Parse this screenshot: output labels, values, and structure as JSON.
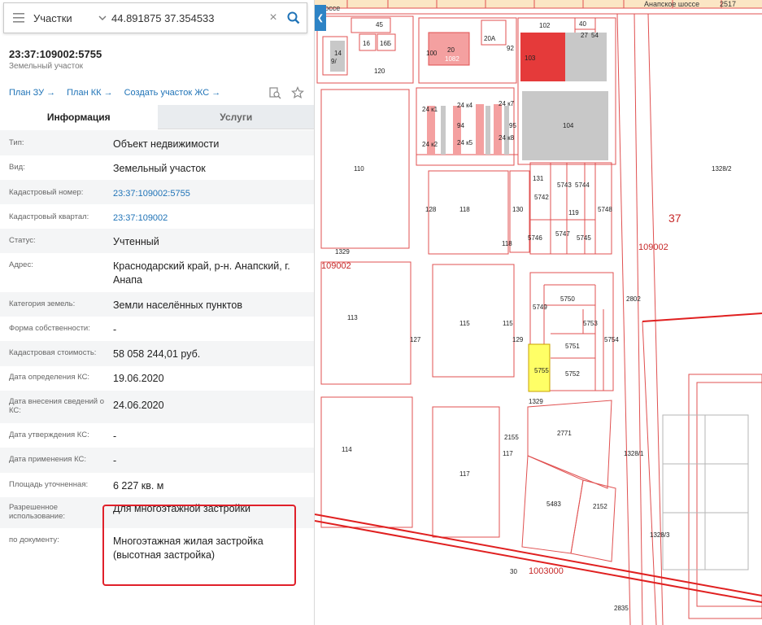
{
  "search": {
    "layer": "Участки",
    "query": "44.891875 37.354533"
  },
  "parcel": {
    "number": "23:37:109002:5755",
    "type_label": "Земельный участок"
  },
  "links": {
    "plan_zu": "План ЗУ →",
    "plan_kk": "План КК →",
    "create": "Создать участок ЖС →"
  },
  "tabs": {
    "info": "Информация",
    "services": "Услуги"
  },
  "rows": [
    {
      "label": "Тип:",
      "value": "Объект недвижимости"
    },
    {
      "label": "Вид:",
      "value": "Земельный участок"
    },
    {
      "label": "Кадастровый номер:",
      "value": "23:37:109002:5755"
    },
    {
      "label": "Кадастровый квартал:",
      "value": "23:37:109002"
    },
    {
      "label": "Статус:",
      "value": "Учтенный"
    },
    {
      "label": "Адрес:",
      "value": "Краснодарский край, р-н. Анапский, г. Анапа"
    },
    {
      "label": "Категория земель:",
      "value": "Земли населённых пунктов"
    },
    {
      "label": "Форма собственности:",
      "value": "-"
    },
    {
      "label": "Кадастровая стоимость:",
      "value": "58 058 244,01 руб."
    },
    {
      "label": "Дата определения КС:",
      "value": "19.06.2020"
    },
    {
      "label": "Дата внесения сведений о КС:",
      "value": "24.06.2020"
    },
    {
      "label": "Дата утверждения КС:",
      "value": "-"
    },
    {
      "label": "Дата применения КС:",
      "value": "-"
    },
    {
      "label": "Площадь уточненная:",
      "value": "6 227 кв. м"
    },
    {
      "label": "Разрешенное использование:",
      "value": "Для многоэтажной застройки"
    },
    {
      "label": "по документу:",
      "value": "Многоэтажная жилая застройка (высотная застройка)"
    }
  ],
  "map": {
    "labels": {
      "top_road_left": "шоссе",
      "top_road_right": "Анапское шоссе",
      "top_road_num": "2517",
      "q_37": "37",
      "q_109002_right": "109002",
      "q_109002_left": "109002",
      "q_1003000": "1003000",
      "p_45": "45",
      "p_16": "16",
      "p_16b": "16Б",
      "p_14": "14",
      "p_9": "9/",
      "p_120": "120",
      "p_100": "100",
      "p_20": "20",
      "p_1082": "1082",
      "p_20a": "20А",
      "p_92": "92",
      "p_102": "102",
      "p_40": "40",
      "p_27": "27",
      "p_54": "54",
      "p_103": "103",
      "p_24k1": "24 к1",
      "p_24k4": "24 к4",
      "p_24k7": "24 к7",
      "p_94": "94",
      "p_24k2": "24 к2",
      "p_24k5": "24 к5",
      "p_24k8": "24 к8",
      "p_95": "95",
      "p_104": "104",
      "p_110": "110",
      "p_1328_2": "1328/2",
      "p_128": "128",
      "p_118": "118",
      "p_130": "130",
      "p_131": "131",
      "p_5743": "5743",
      "p_5744": "5744",
      "p_5742": "5742",
      "p_119": "119",
      "p_5748": "5748",
      "p_5746": "5746",
      "p_5747": "5747",
      "p_5745": "5745",
      "p_118b": "118",
      "p_1329": "1329",
      "p_2802": "2802",
      "p_113": "113",
      "p_127": "127",
      "p_115": "115",
      "p_115b": "115",
      "p_129": "129",
      "p_5749": "5749",
      "p_5750": "5750",
      "p_5753": "5753",
      "p_5754": "5754",
      "p_5751": "5751",
      "p_5755": "5755",
      "p_5752": "5752",
      "p_1329b": "1329",
      "p_114": "114",
      "p_2155": "2155",
      "p_117": "117",
      "p_117b": "117",
      "p_2771": "2771",
      "p_1328_1": "1328/1",
      "p_5483": "5483",
      "p_2152": "2152",
      "p_1328_3": "1328/3",
      "p_30": "30",
      "p_2835": "2835"
    }
  }
}
